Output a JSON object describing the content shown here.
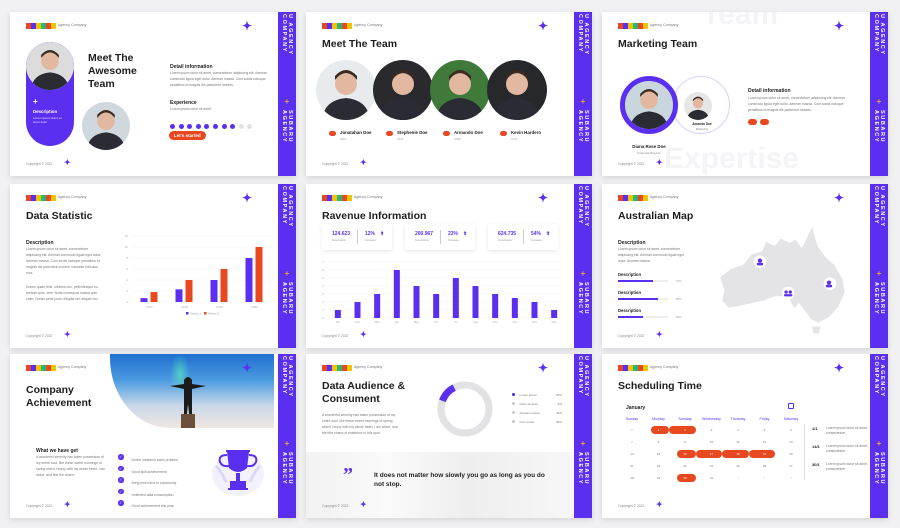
{
  "brand": {
    "logo_letters": [
      "S",
      "U",
      "B",
      "A",
      "R",
      "U"
    ],
    "logo_colors": [
      "#e8481f",
      "#5b2ff0",
      "#f5c400",
      "#2bb673",
      "#e8481f",
      "#f5c400"
    ],
    "company": "Agency Company",
    "copyright": "Copyright © 2022",
    "strip_a": "U AGENCY COMPANY",
    "strip_plus": "+",
    "strip_b": "SUBARU AGENCY",
    "accent": "#5b2ff0",
    "orange": "#e8481f"
  },
  "slide1": {
    "title": "Meet The Awesome Team",
    "card_title": "Description",
    "card_text": "Lorem ipsum dolor sit amet dolor",
    "detail_title": "Detail information",
    "detail_text": "Lorem ipsum dolor sit amet, consectetuer adipiscing elit. Aenean commodo ligula eget dolor. Aenean massa. Cum sociis natoque penatibus et magnis dis parturient montes.",
    "experience_title": "Experience",
    "experience_text": "Lorem ipsum dolor sit amet",
    "experience_level": 8,
    "experience_max": 10,
    "button": "Let's started"
  },
  "slide2": {
    "title": "Meet The Team",
    "members": [
      {
        "name": "Jonatahan Doe",
        "role": "CEO"
      },
      {
        "name": "Stephenie Doe",
        "role": "CFO"
      },
      {
        "name": "Armando Doe",
        "role": "CMO"
      },
      {
        "name": "Kevin Hardero",
        "role": "CTO"
      }
    ]
  },
  "slide3": {
    "title": "Marketing Team",
    "bg_word_top": "Team",
    "bg_word_bottom": "Expertise",
    "main_name": "Diana Rose Doe",
    "main_role": "Financial Director",
    "second_name": "Amanda Doe",
    "second_role": "Marketing",
    "detail_title": "Detail information",
    "detail_text": "Lorem ipsum dolor sit amet, consectetuer adipiscing elit. Aenean commodo ligula eget dolor. Aenean massa. Cum sociis natoque penatibus et magnis dis parturient montes."
  },
  "slide4": {
    "title": "Data Statistic",
    "desc_title": "Description",
    "desc_text1": "Lorem ipsum dolor sit amet, consectetuer adipiscing elit. Aenean commodo ligula eget dolor. Aenean massa. Cum sociis natoque penatibus et magnis dis parturient montes, nascetur ridiculus mus.",
    "desc_text2": "Donec quam felis, ultricies nec, pellentesque eu, pretium quis, sem. Nulla consequat massa quis enim. Donec pede justo, fringilla vel, aliquet nec."
  },
  "slide5": {
    "title": "Ravenue Information",
    "stats": [
      {
        "value": "124.623",
        "label": "Description",
        "pct": "12%",
        "pct_label": "Increase"
      },
      {
        "value": "200.967",
        "label": "Description",
        "pct": "23%",
        "pct_label": "Increase"
      },
      {
        "value": "624.735",
        "label": "Description",
        "pct": "54%",
        "pct_label": "Increase"
      }
    ]
  },
  "slide6": {
    "title": "Australian Map",
    "desc_title": "Description",
    "desc_text": "Lorem ipsum dolor sit amet, consectetuer adipiscing elit. Aenean commodo ligula eget dolor. Aenean massa.",
    "bars": [
      {
        "label": "Description",
        "value": 70,
        "pct": "70%"
      },
      {
        "label": "Description",
        "value": 80,
        "pct": "80%"
      },
      {
        "label": "Description",
        "value": 50,
        "pct": "50%"
      }
    ]
  },
  "slide7": {
    "title": "Company Achievement",
    "sub_title": "What we have get",
    "sub_text": "A wonderful serenity has taken possession of my entire soul, like these sweet mornings of spring which I enjoy with my whole heart. I am alone, and feel the charm.",
    "checklist": [
      "Online weekend sales problem",
      "Good skill achievement",
      "Bring new trend to community",
      "Unlimited data consumption",
      "Good achievement this year"
    ]
  },
  "slide8": {
    "title": "Data Audience & Consument",
    "text": "A wonderful serenity has taken possession of my entire soul, like these sweet mornings of spring which I enjoy with my whole heart. I am alone, and feel the charm of existence in this spot.",
    "donut_fraction": 0.12,
    "legend": [
      {
        "label": "Lorem ipsum",
        "value": "25%"
      },
      {
        "label": "Dolor sit amet",
        "value": "5%"
      },
      {
        "label": "Aenean massa",
        "value": "40%"
      },
      {
        "label": "Cum sociis",
        "value": "30%"
      }
    ],
    "quote_mark": "”",
    "quote": "It does not matter how slowly you go as long as you do not stop."
  },
  "slide9": {
    "title": "Scheduling Time",
    "month": "January",
    "weekdays": [
      "Sunday",
      "Monday",
      "Tuesday",
      "Wednesday",
      "Thursday",
      "Friday",
      "Saturday"
    ],
    "days": [
      31,
      1,
      2,
      3,
      4,
      5,
      6,
      7,
      8,
      9,
      10,
      11,
      12,
      13,
      14,
      15,
      16,
      17,
      18,
      19,
      20,
      21,
      22,
      23,
      24,
      25,
      26,
      27,
      28,
      29,
      30,
      31,
      1,
      2,
      3
    ],
    "highlighted": [
      1,
      2,
      16,
      17,
      18,
      19,
      30
    ],
    "notes": [
      {
        "date": "1/1",
        "text": "Lorem ipsum dolor sit amet, consectetuer"
      },
      {
        "date": "14/1",
        "text": "Lorem ipsum dolor sit amet, consectetuer"
      },
      {
        "date": "30/1",
        "text": "Lorem ipsum dolor sit amet, consectetuer"
      }
    ]
  },
  "chart_data": [
    {
      "type": "bar",
      "categories": [
        "2017",
        "2018",
        "2019",
        "2020"
      ],
      "series": [
        {
          "name": "Series 1",
          "values": [
            0.7,
            2.3,
            4,
            8
          ],
          "color": "#5b2ff0"
        },
        {
          "name": "Series 2",
          "values": [
            1.8,
            4,
            6,
            10
          ],
          "color": "#e8481f"
        }
      ],
      "yticks": [
        0,
        2,
        4,
        6,
        8,
        10,
        12
      ],
      "ylim": [
        0,
        12
      ],
      "legend": "bottom",
      "grid": true
    },
    {
      "type": "bar",
      "categories": [
        "Jan",
        "Feb",
        "Mar",
        "Apr",
        "May",
        "Jun",
        "Jul",
        "Aug",
        "Sep",
        "Oct",
        "Nov",
        "Dec"
      ],
      "values": [
        1,
        2,
        3,
        6,
        4,
        3,
        5,
        4,
        3,
        2.5,
        2,
        1
      ],
      "yticks": [
        0,
        1,
        2,
        3,
        4,
        5,
        6,
        7
      ],
      "ylim": [
        0,
        7
      ],
      "color": "#5b2ff0",
      "grid": true
    }
  ]
}
